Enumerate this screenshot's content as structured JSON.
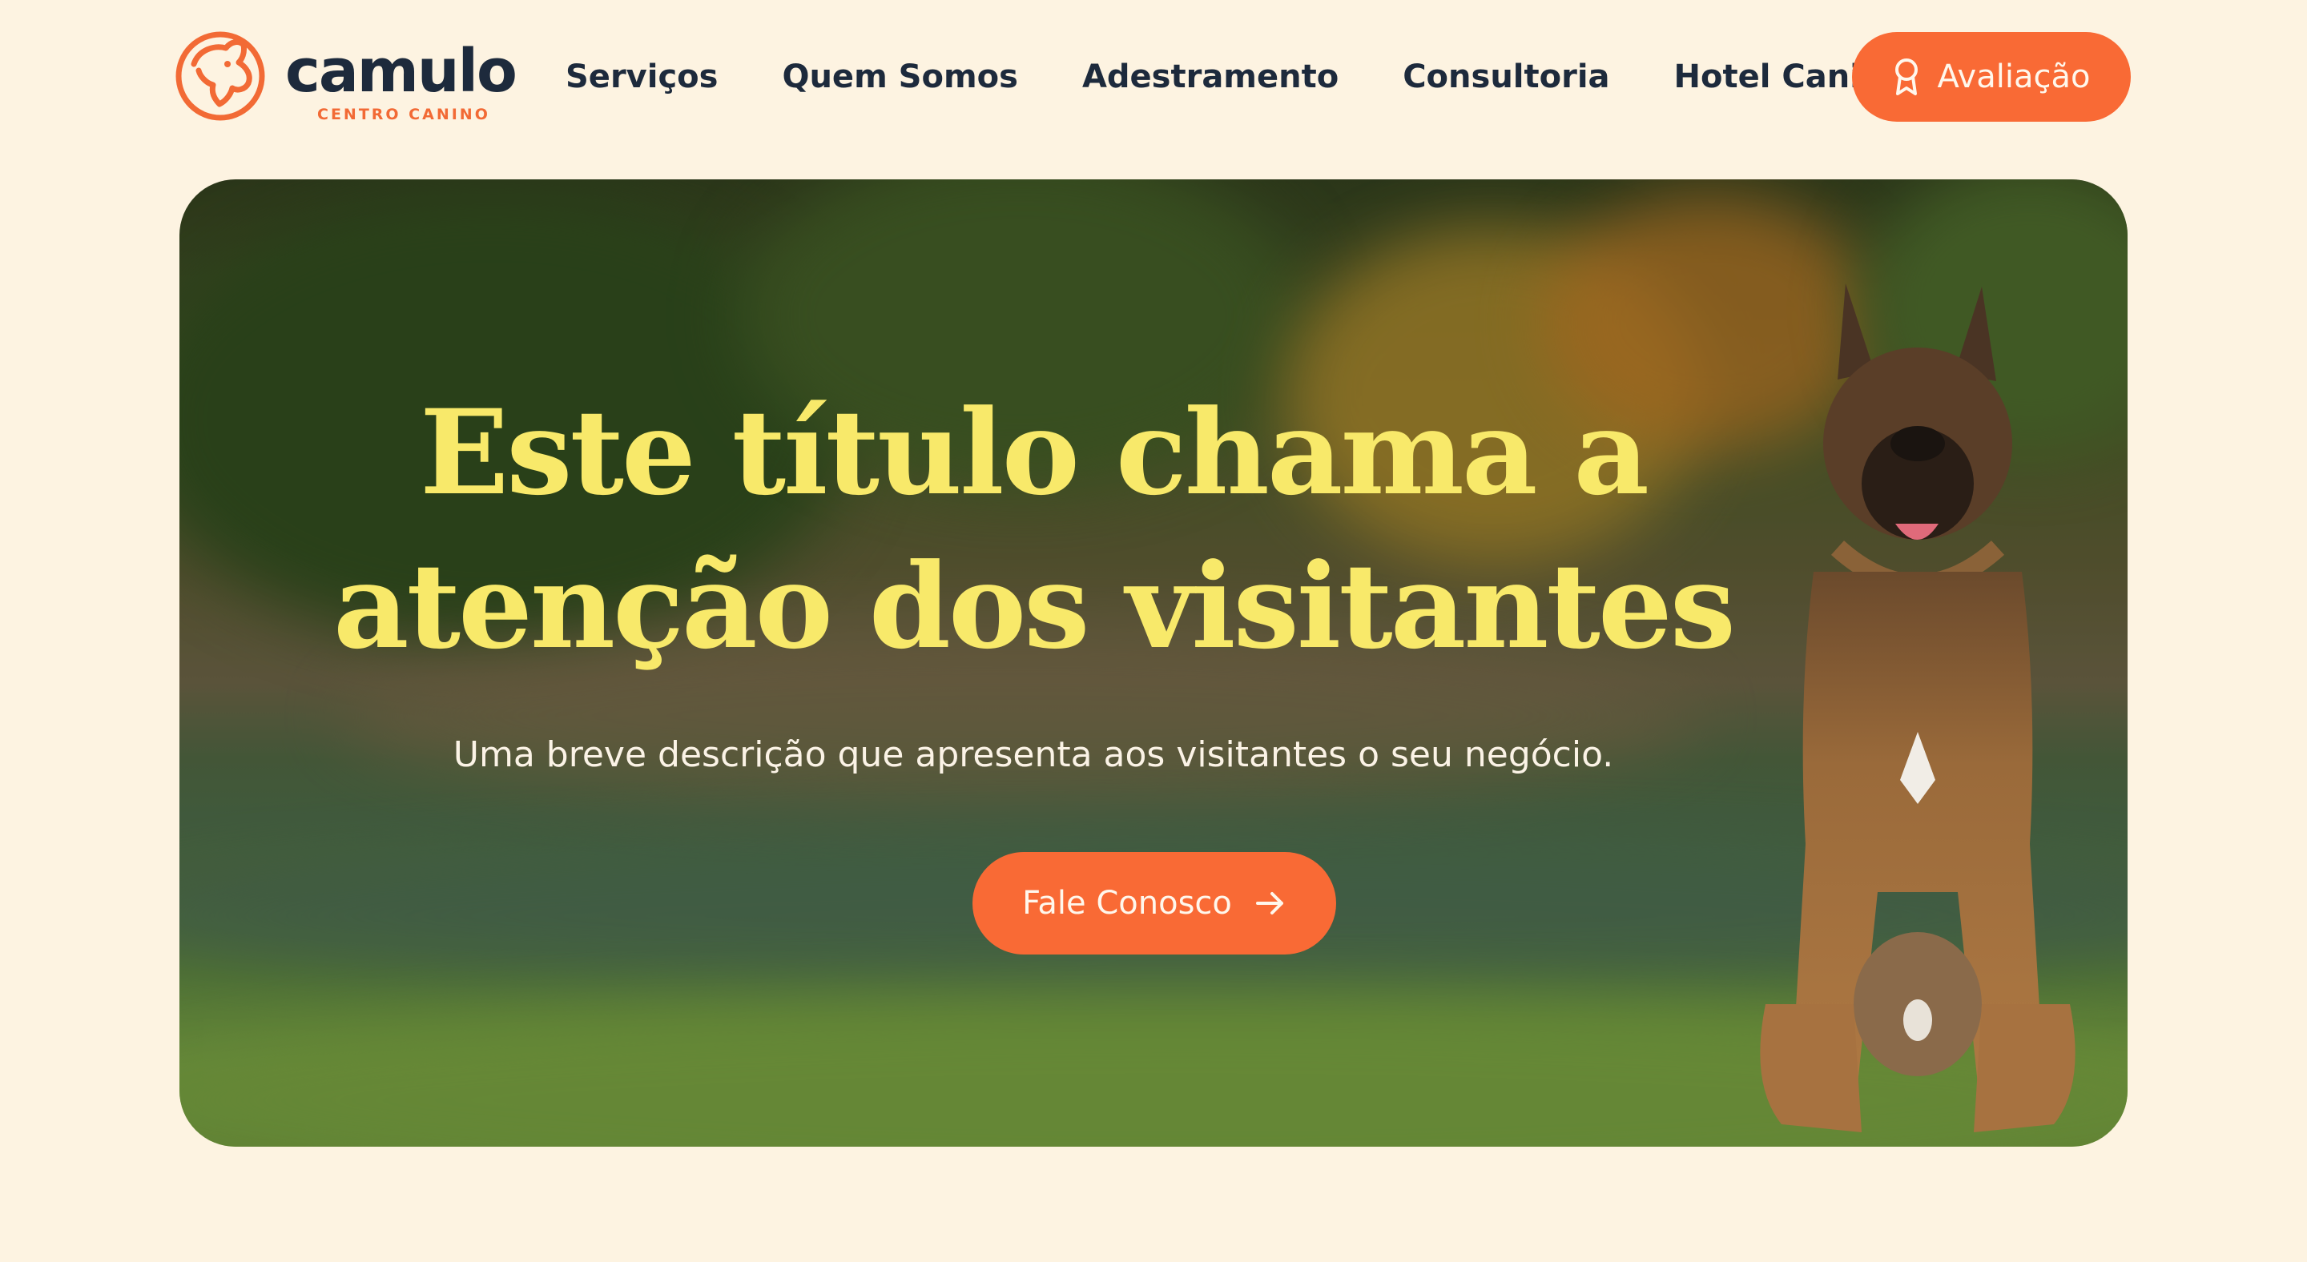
{
  "brand": {
    "name": "camulo",
    "tagline": "CENTRO CANINO",
    "logo_icon": "dog-head-icon",
    "primary_color": "#f96a35",
    "dark_color": "#1d2a3c",
    "background_color": "#fdf3e1"
  },
  "nav": {
    "items": [
      {
        "label": "Serviços"
      },
      {
        "label": "Quem Somos"
      },
      {
        "label": "Adestramento"
      },
      {
        "label": "Consultoria"
      },
      {
        "label": "Hotel Canino"
      }
    ]
  },
  "header_cta": {
    "label": "Avaliação",
    "icon": "award-ribbon-icon"
  },
  "hero": {
    "title_line1": "Este título chama a",
    "title_line2": "atenção dos visitantes",
    "title_color": "#f8e96a",
    "description": "Uma breve descrição que apresenta aos visitantes o seu negócio.",
    "cta_label": "Fale Conosco",
    "cta_icon": "arrow-right-icon",
    "image": "dog-sitting-in-park-photo"
  }
}
